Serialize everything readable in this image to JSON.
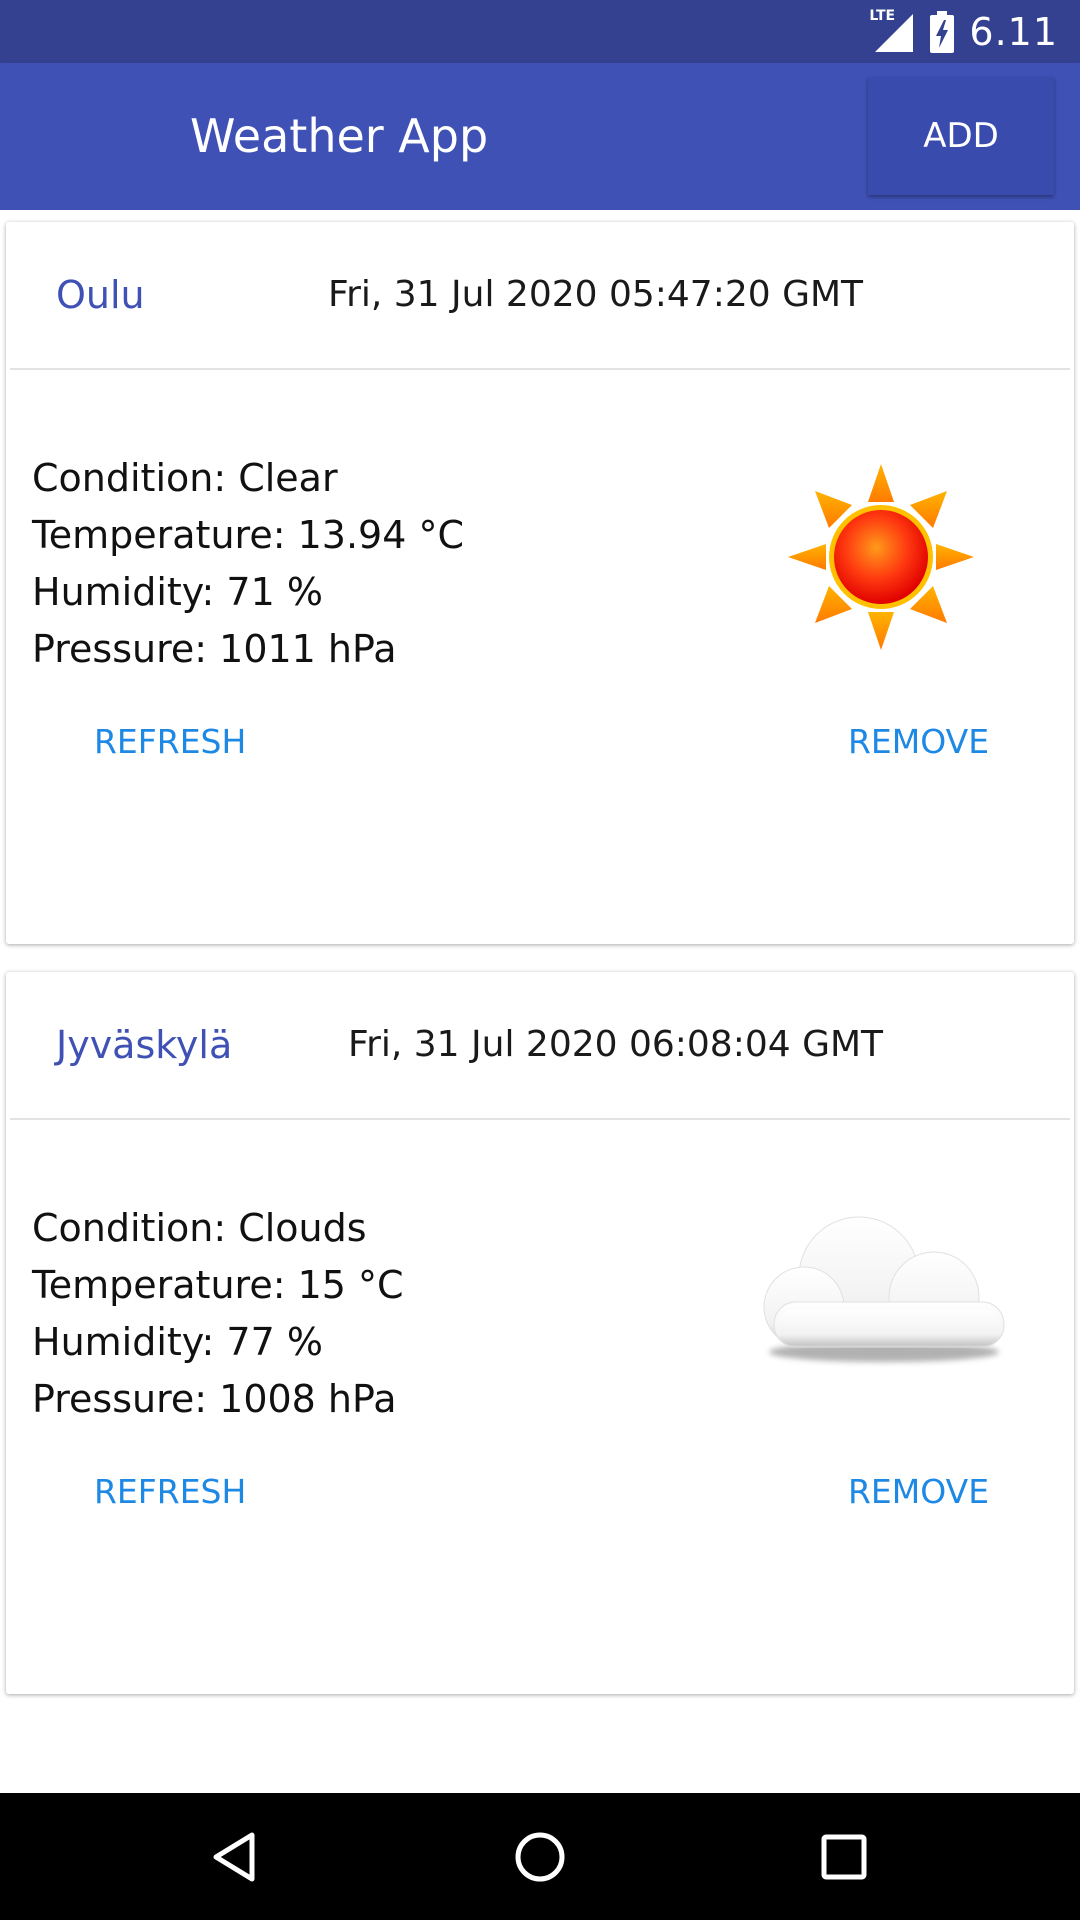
{
  "status_bar": {
    "network": "LTE",
    "time": "6.11"
  },
  "app_bar": {
    "title": "Weather App",
    "add_label": "ADD"
  },
  "cards": [
    {
      "city": "Oulu",
      "timestamp": "Fri, 31 Jul 2020 05:47:20 GMT",
      "condition": "Condition: Clear",
      "temperature": "Temperature: 13.94 °C",
      "humidity": "Humidity: 71 %",
      "pressure": "Pressure: 1011 hPa",
      "icon": "sun-icon",
      "refresh_label": "REFRESH",
      "remove_label": "REMOVE"
    },
    {
      "city": "Jyväskylä",
      "timestamp": "Fri, 31 Jul 2020 06:08:04 GMT",
      "condition": "Condition: Clouds",
      "temperature": "Temperature: 15 °C",
      "humidity": "Humidity: 77 %",
      "pressure": "Pressure: 1008 hPa",
      "icon": "cloud-icon",
      "refresh_label": "REFRESH",
      "remove_label": "REMOVE"
    }
  ],
  "colors": {
    "status_bar": "#334190",
    "primary": "#3F51B5",
    "button_text": "#1E88E5"
  }
}
